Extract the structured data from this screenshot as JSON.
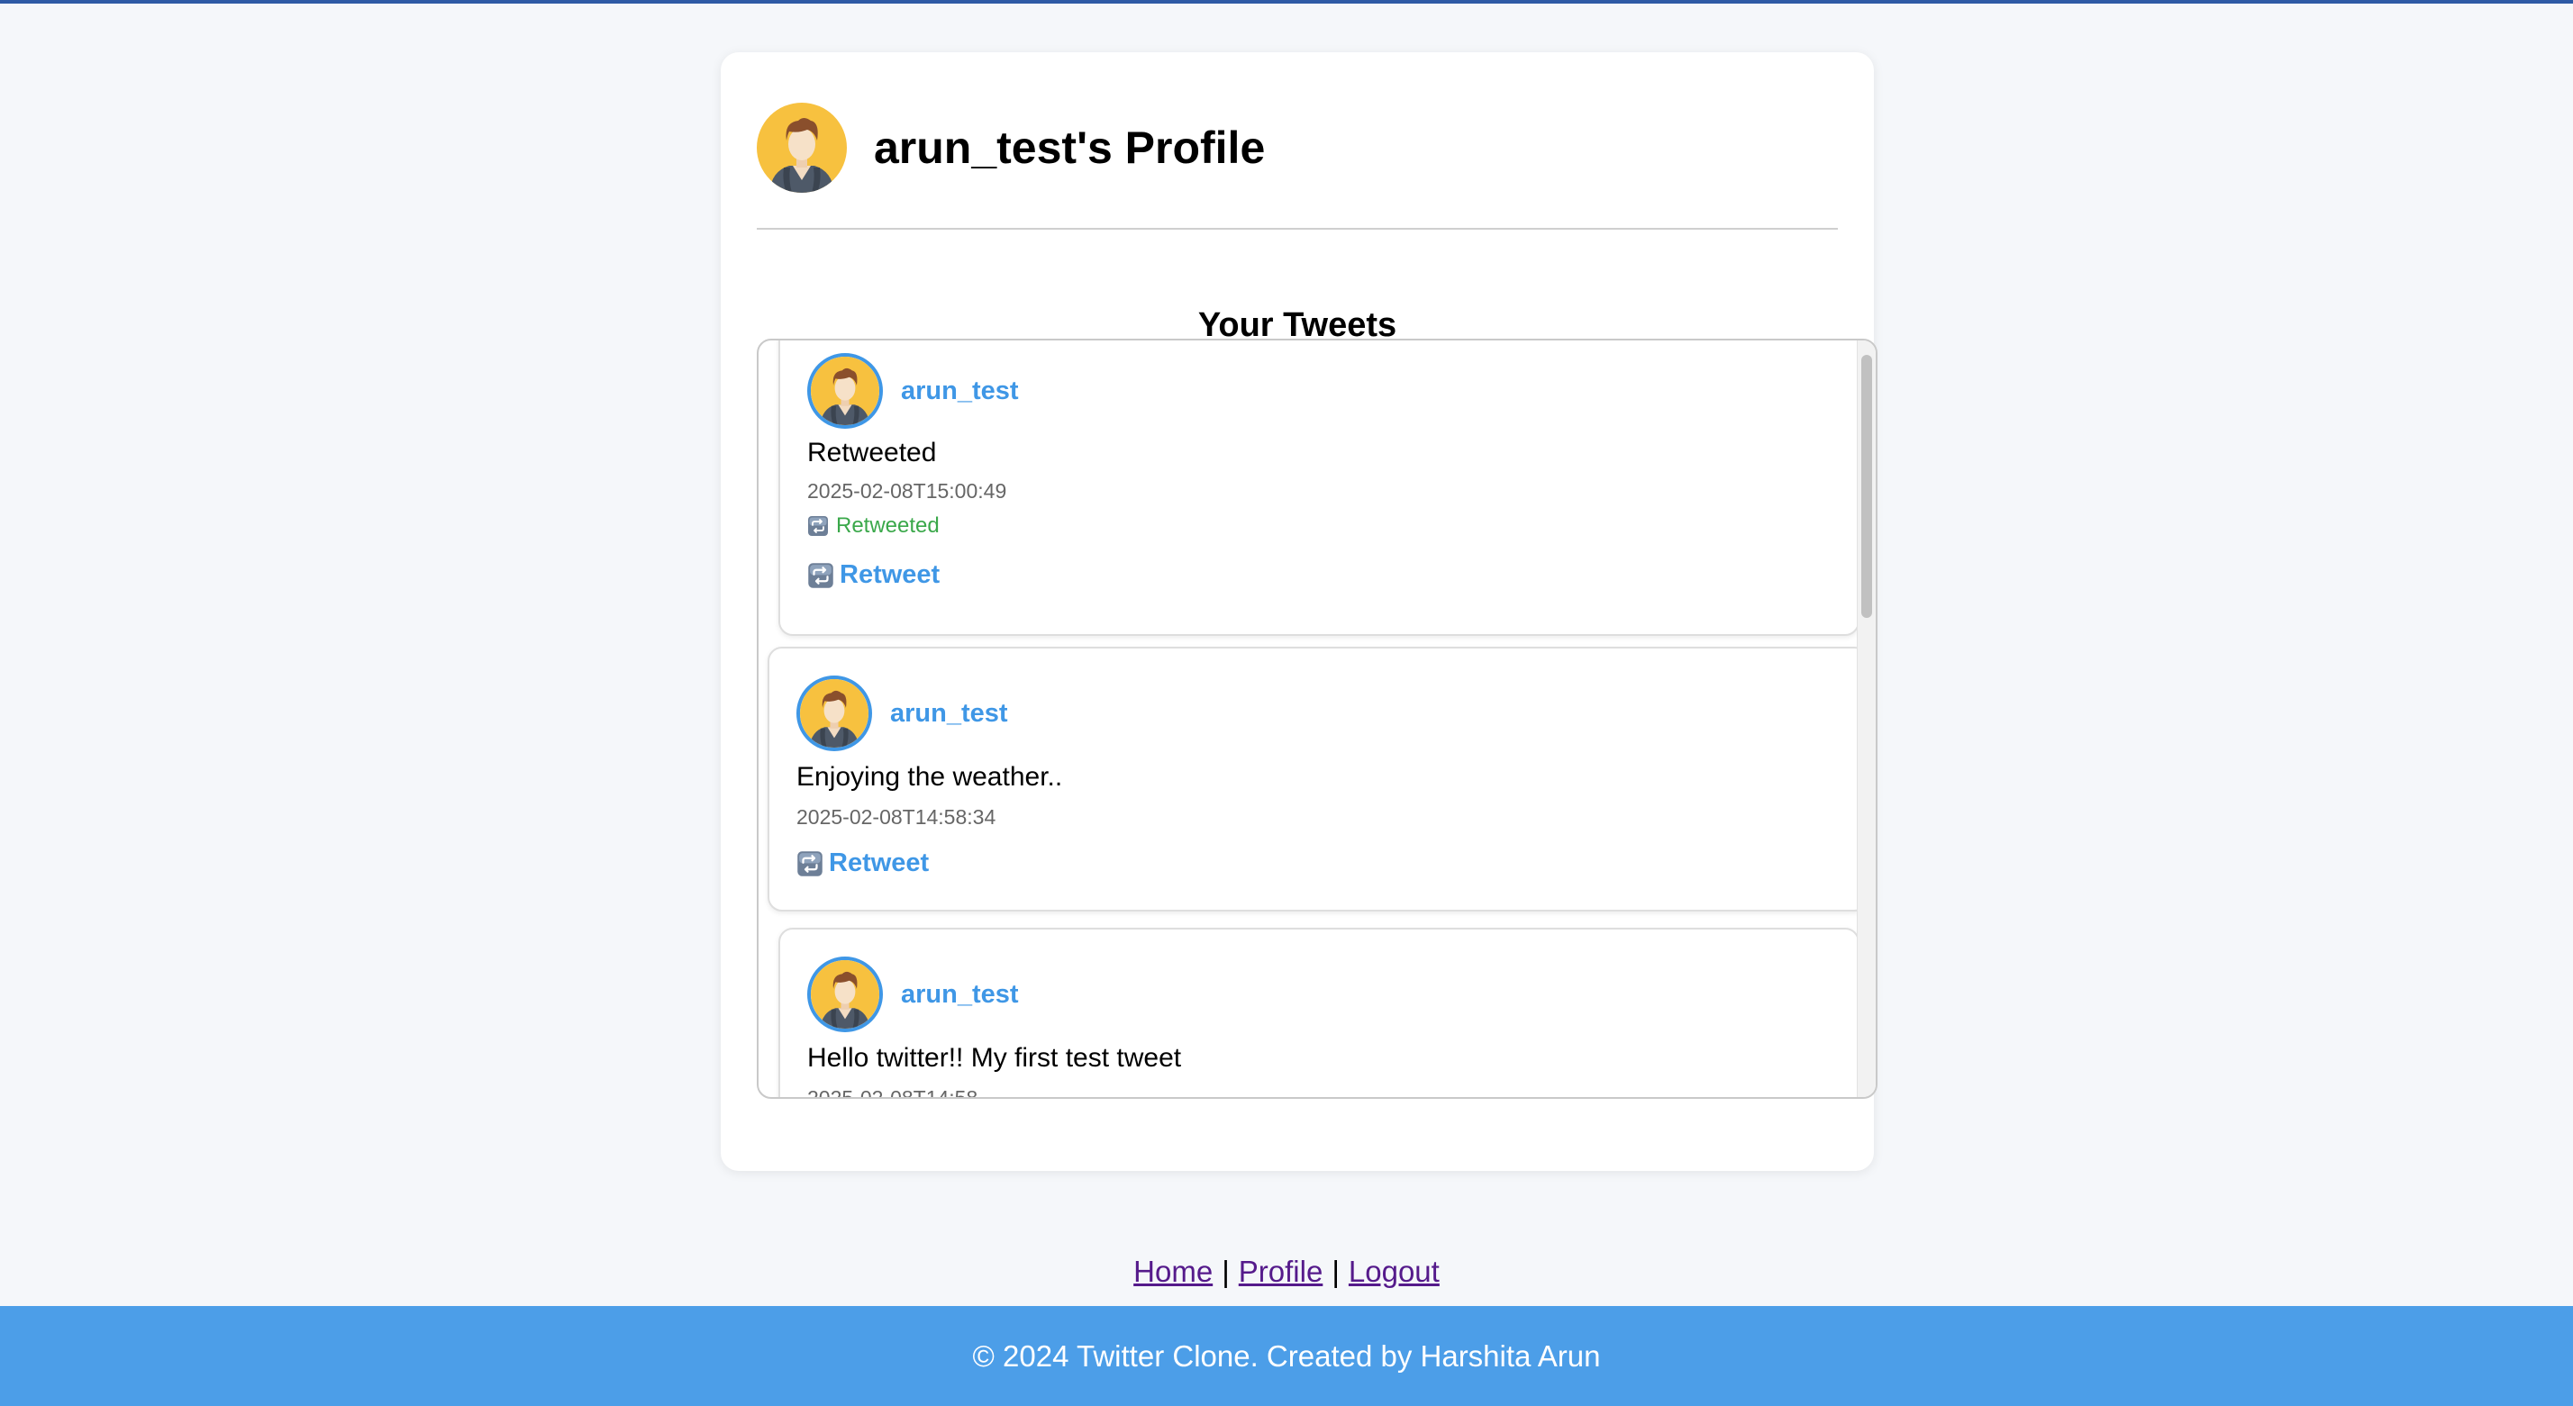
{
  "profile": {
    "title": "arun_test's Profile"
  },
  "section": {
    "title": "Your Tweets"
  },
  "tweets": [
    {
      "username": "arun_test",
      "text": "Retweeted",
      "timestamp": "2025-02-08T15:00:49",
      "retweeted_label": "Retweeted",
      "retweet_button": "Retweet"
    },
    {
      "username": "arun_test",
      "text": "Enjoying the weather..",
      "timestamp": "2025-02-08T14:58:34",
      "retweet_button": "Retweet"
    },
    {
      "username": "arun_test",
      "text": "Hello twitter!! My first test tweet",
      "timestamp": "2025-02-08T14:58"
    }
  ],
  "nav": {
    "home": "Home",
    "profile": "Profile",
    "logout": "Logout",
    "separator": "|"
  },
  "footer": {
    "text": "© 2024 Twitter Clone. Created by Harshita Arun"
  },
  "colors": {
    "accent": "#3f97e6",
    "footer_bg": "#4c9ee8",
    "retweeted": "#3aa84a",
    "avatar_bg": "#f7c13f",
    "top_bar": "#2e5aa5"
  },
  "icons": {
    "avatar": "user-avatar-icon",
    "retweet": "retweet-icon"
  }
}
